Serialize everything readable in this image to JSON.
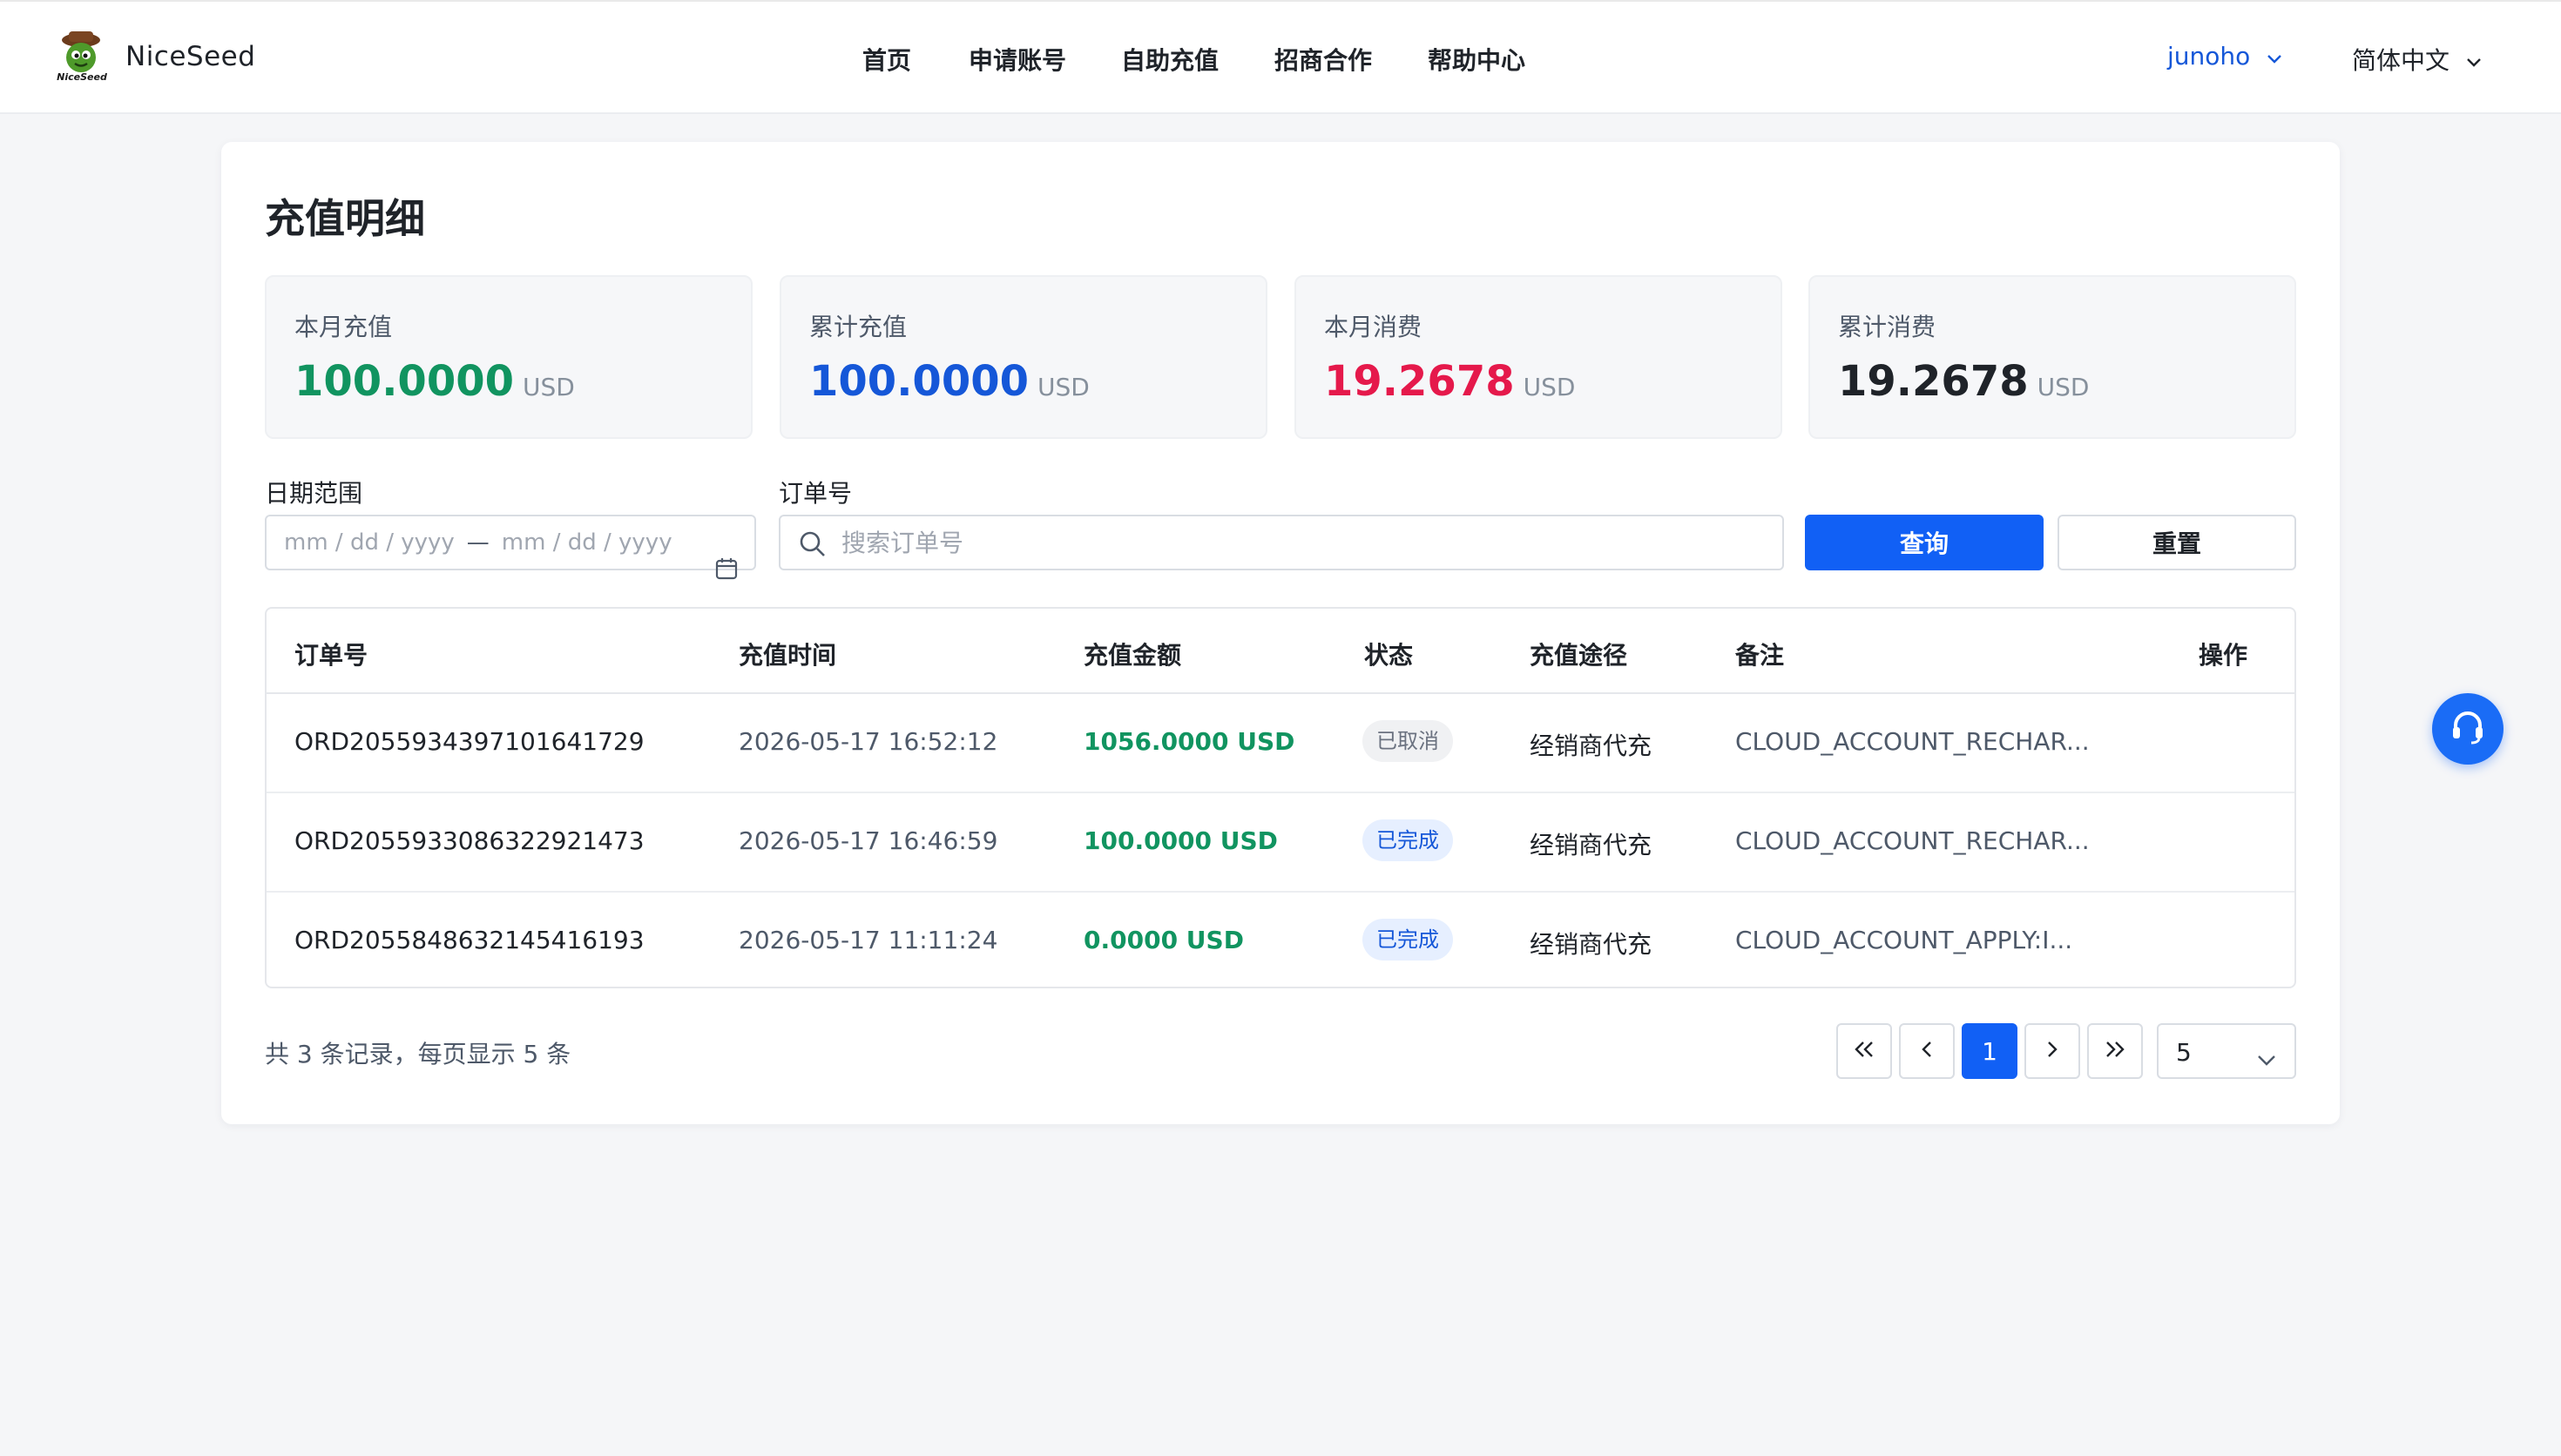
{
  "header": {
    "brand": "NiceSeed",
    "logo_caption": "NiceSeed",
    "nav": [
      "首页",
      "申请账号",
      "自助充值",
      "招商合作",
      "帮助中心"
    ],
    "user": "junoho",
    "language": "简体中文"
  },
  "page": {
    "title": "充值明细"
  },
  "stats": [
    {
      "label": "本月充值",
      "value": "100.0000",
      "unit": "USD",
      "color": "#119460"
    },
    {
      "label": "累计充值",
      "value": "100.0000",
      "unit": "USD",
      "color": "#1557d8"
    },
    {
      "label": "本月消费",
      "value": "19.2678",
      "unit": "USD",
      "color": "#e5194b"
    },
    {
      "label": "累计消费",
      "value": "19.2678",
      "unit": "USD",
      "color": "#1f2329"
    }
  ],
  "filters": {
    "date_label": "日期范围",
    "date_placeholder_start": "mm / dd / yyyy",
    "date_separator": "—",
    "date_placeholder_end": "mm / dd / yyyy",
    "order_label": "订单号",
    "order_placeholder": "搜索订单号",
    "query_button": "查询",
    "reset_button": "重置"
  },
  "table": {
    "columns": [
      "订单号",
      "充值时间",
      "充值金额",
      "状态",
      "充值途径",
      "备注",
      "操作"
    ],
    "rows": [
      {
        "order": "ORD2055934397101641729",
        "time": "2026-05-17 16:52:12",
        "amount": "1056.0000 USD",
        "status": "已取消",
        "status_type": "cancel",
        "channel": "经销商代充",
        "note": "CLOUD_ACCOUNT_RECHAR..."
      },
      {
        "order": "ORD2055933086322921473",
        "time": "2026-05-17 16:46:59",
        "amount": "100.0000 USD",
        "status": "已完成",
        "status_type": "done",
        "channel": "经销商代充",
        "note": "CLOUD_ACCOUNT_RECHAR..."
      },
      {
        "order": "ORD2055848632145416193",
        "time": "2026-05-17 11:11:24",
        "amount": "0.0000 USD",
        "status": "已完成",
        "status_type": "done",
        "channel": "经销商代充",
        "note": "CLOUD_ACCOUNT_APPLY:I..."
      }
    ]
  },
  "pagination": {
    "summary": "共 3 条记录，每页显示 5 条",
    "current_page": "1",
    "page_size": "5"
  },
  "colors": {
    "primary": "#1160f5",
    "accent_green": "#119460",
    "accent_red": "#e5194b"
  },
  "icons": {
    "first": "double-chevron-left-icon",
    "prev": "chevron-left-icon",
    "next": "chevron-right-icon",
    "last": "double-chevron-right-icon",
    "support": "headset-icon",
    "calendar": "calendar-icon",
    "search": "search-icon"
  }
}
